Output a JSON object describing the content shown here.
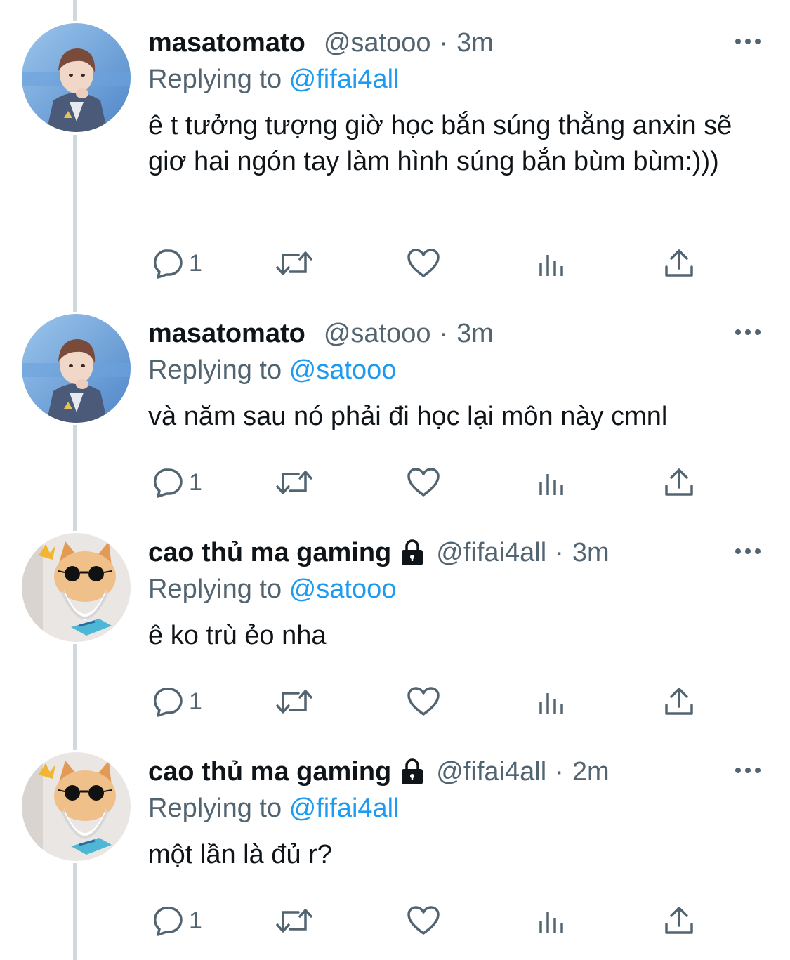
{
  "tweets": [
    {
      "display_name": "masatomato",
      "handle": "@satooo",
      "separator": "·",
      "time": "3m",
      "locked": false,
      "avatar": "avatar-person",
      "replying_prefix": "Replying to ",
      "replying_to": "@fifai4all",
      "text": "ê t tưởng tượng giờ học bắn súng thằng anxin sẽ giơ hai ngón tay làm hình súng bắn bùm bùm:)))",
      "reply_count": "1"
    },
    {
      "display_name": "masatomato",
      "handle": "@satooo",
      "separator": "·",
      "time": "3m",
      "locked": false,
      "avatar": "avatar-person",
      "replying_prefix": "Replying to ",
      "replying_to": "@satooo",
      "text": "và năm sau nó phải đi học lại môn này cmnl",
      "reply_count": "1"
    },
    {
      "display_name": "cao thủ ma gaming",
      "handle": "@fifai4all",
      "separator": "·",
      "time": "3m",
      "locked": true,
      "avatar": "avatar-cat",
      "replying_prefix": "Replying to ",
      "replying_to": "@satooo",
      "text": "ê ko trù ẻo nha",
      "reply_count": "1"
    },
    {
      "display_name": "cao thủ ma gaming",
      "handle": "@fifai4all",
      "separator": "·",
      "time": "2m",
      "locked": true,
      "avatar": "avatar-cat",
      "replying_prefix": "Replying to ",
      "replying_to": "@fifai4all",
      "text": "một lần là đủ r?",
      "reply_count": "1"
    }
  ],
  "icons": {
    "reply": "reply-icon",
    "retweet": "retweet-icon",
    "like": "like-icon",
    "views": "views-icon",
    "share": "share-icon",
    "more": "more-icon",
    "lock": "lock-icon"
  },
  "colors": {
    "link": "#1d9bf0",
    "secondary_text": "#536471",
    "primary_text": "#0f1419",
    "thread_line": "#cfd9de"
  }
}
